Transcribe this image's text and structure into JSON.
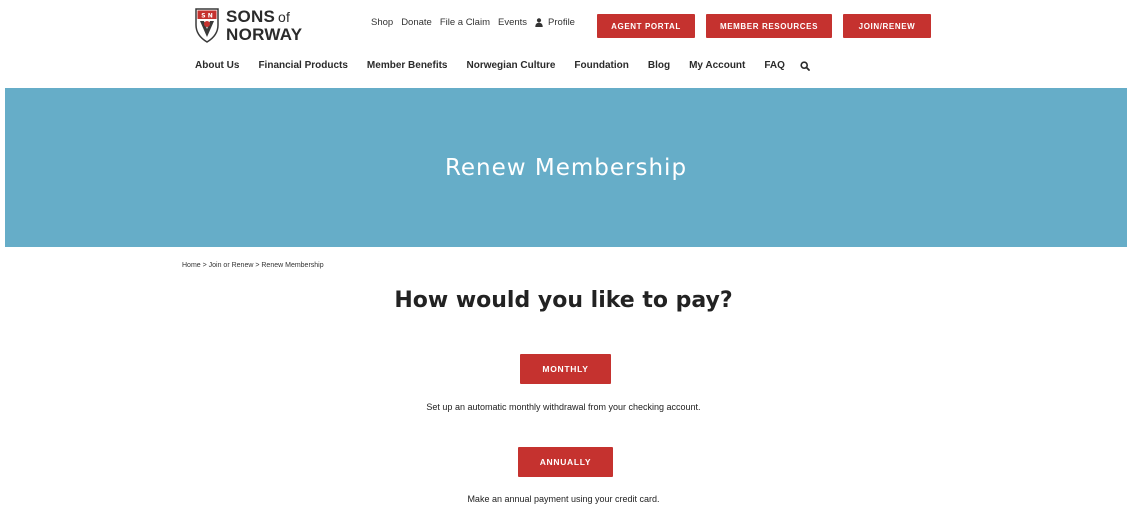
{
  "logo": {
    "line1": "SONS",
    "line1_of": "of",
    "line2": "NORWAY",
    "icon": "sons-of-norway-shield-icon"
  },
  "utility_nav": {
    "items": [
      "Shop",
      "Donate",
      "File a Claim",
      "Events"
    ],
    "profile_label": "Profile",
    "profile_icon": "user-icon"
  },
  "header_buttons": {
    "agent_portal": "AGENT PORTAL",
    "member_resources": "MEMBER RESOURCES",
    "join_renew": "JOIN/RENEW"
  },
  "main_nav": {
    "items": [
      "About Us",
      "Financial Products",
      "Member Benefits",
      "Norwegian Culture",
      "Foundation",
      "Blog",
      "My Account",
      "FAQ"
    ],
    "search_icon": "search-icon"
  },
  "hero": {
    "title": "Renew Membership"
  },
  "breadcrumb": {
    "text": "Home > Join or Renew > Renew Membership"
  },
  "main": {
    "question": "How would you like to pay?",
    "monthly": {
      "button": "MONTHLY",
      "description": "Set up an automatic monthly withdrawal from your checking account."
    },
    "annually": {
      "button": "ANNUALLY",
      "description": "Make an annual payment using your credit card."
    }
  },
  "colors": {
    "brand_red": "#c5322f",
    "hero_blue": "#66adc8"
  }
}
